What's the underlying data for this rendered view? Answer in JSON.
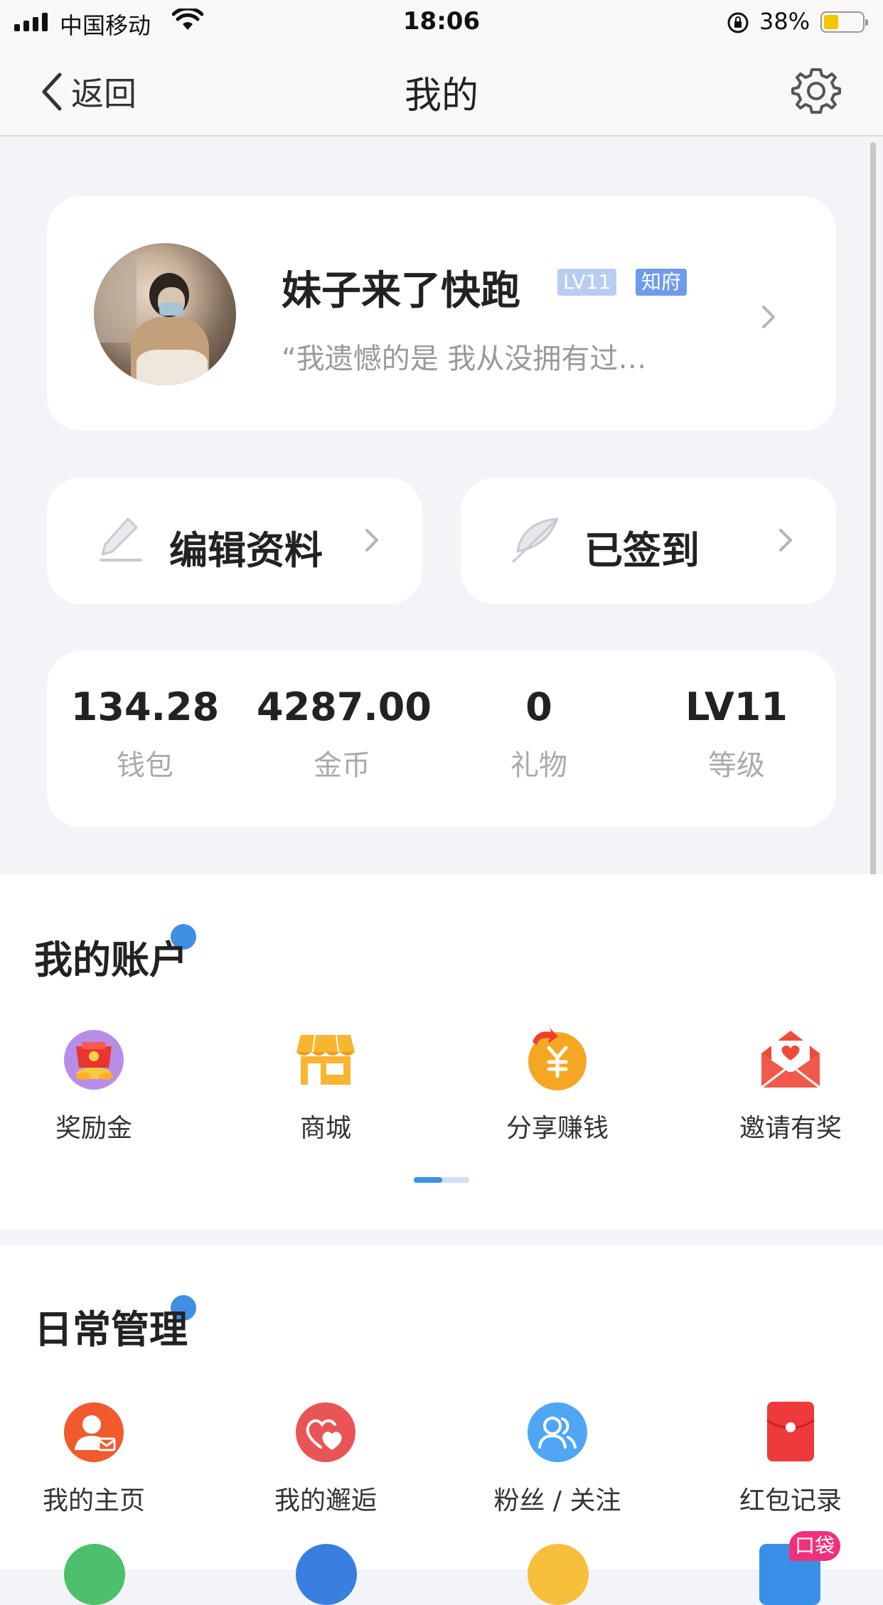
{
  "status_bar": {
    "carrier": "中国移动",
    "time": "18:06",
    "battery": "38%",
    "battery_level": 0.38,
    "icons": [
      "signal-icon",
      "wifi-icon",
      "rotation-lock-icon",
      "battery-icon"
    ]
  },
  "nav": {
    "back_label": "返回",
    "title": "我的",
    "settings_icon": "gear-icon"
  },
  "profile": {
    "name": "妹子来了快跑",
    "level_badge": "LV11",
    "title_badge": "知府",
    "signature": "“我遗憾的是 我从没拥有过…"
  },
  "actions": {
    "edit_label": "编辑资料",
    "sign_label": "已签到"
  },
  "stats": [
    {
      "value": "134.28",
      "label": "钱包"
    },
    {
      "value": "4287.00",
      "label": "金币"
    },
    {
      "value": "0",
      "label": "礼物"
    },
    {
      "value": "LV11",
      "label": "等级"
    }
  ],
  "account": {
    "title": "我的账户",
    "items": [
      {
        "label": "奖励金",
        "icon": "reward-icon"
      },
      {
        "label": "商城",
        "icon": "shop-icon"
      },
      {
        "label": "分享赚钱",
        "icon": "share-money-icon"
      },
      {
        "label": "邀请有奖",
        "icon": "invite-envelope-icon"
      }
    ]
  },
  "daily": {
    "title": "日常管理",
    "items": [
      {
        "label": "我的主页",
        "icon": "homepage-icon"
      },
      {
        "label": "我的邂逅",
        "icon": "encounter-heart-icon"
      },
      {
        "label": "粉丝 / 关注",
        "icon": "fans-icon"
      },
      {
        "label": "红包记录",
        "icon": "red-packet-icon"
      }
    ],
    "promo_tag": "口袋"
  },
  "colors": {
    "accent": "#3f8fe3",
    "background": "#f3f4f7",
    "badge_level": "#b9cdf3",
    "badge_title": "#6f9bea"
  }
}
